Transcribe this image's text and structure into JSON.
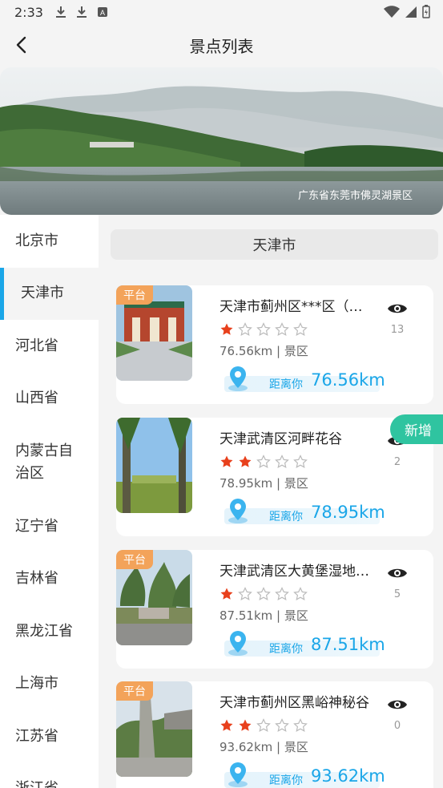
{
  "status_bar": {
    "time": "2:33"
  },
  "header": {
    "title": "景点列表"
  },
  "banner": {
    "caption": "广东省东莞市佛灵湖景区"
  },
  "sidebar": {
    "items": [
      {
        "label": "北京市"
      },
      {
        "label": "天津市"
      },
      {
        "label": "河北省"
      },
      {
        "label": "山西省"
      },
      {
        "label": "内蒙古自治区"
      },
      {
        "label": "辽宁省"
      },
      {
        "label": "吉林省"
      },
      {
        "label": "黑龙江省"
      },
      {
        "label": "上海市"
      },
      {
        "label": "江苏省"
      },
      {
        "label": "浙江省"
      }
    ],
    "active": "天津市"
  },
  "province_bar": {
    "label": "天津市"
  },
  "cards": [
    {
      "tag": "平台",
      "title": "天津市蓟州区***区（…",
      "rating": 1,
      "distance_line": "76.56km | 景区",
      "dist_label": "距离你",
      "dist_value": "76.56km",
      "views": "13"
    },
    {
      "tag": "",
      "title": "天津武清区河畔花谷",
      "rating": 2,
      "distance_line": "78.95km | 景区",
      "dist_label": "距离你",
      "dist_value": "78.95km",
      "views": "2",
      "badge": "新增"
    },
    {
      "tag": "平台",
      "title": "天津武清区大黄堡湿地…",
      "rating": 1,
      "distance_line": "87.51km | 景区",
      "dist_label": "距离你",
      "dist_value": "87.51km",
      "views": "5"
    },
    {
      "tag": "平台",
      "title": "天津市蓟州区黑峪神秘谷",
      "rating": 2,
      "distance_line": "93.62km | 景区",
      "dist_label": "距离你",
      "dist_value": "93.62km",
      "views": "0"
    }
  ],
  "colors": {
    "accent": "#1aa6e8",
    "tag": "#f3a35a",
    "new_badge": "#2fc4a0",
    "star_filled": "#e8401c",
    "star_empty": "#bbbbbb"
  },
  "icons": {
    "back": "chevron-left-icon",
    "eye": "eye-icon",
    "pin": "location-pin-icon",
    "star": "star-icon"
  }
}
